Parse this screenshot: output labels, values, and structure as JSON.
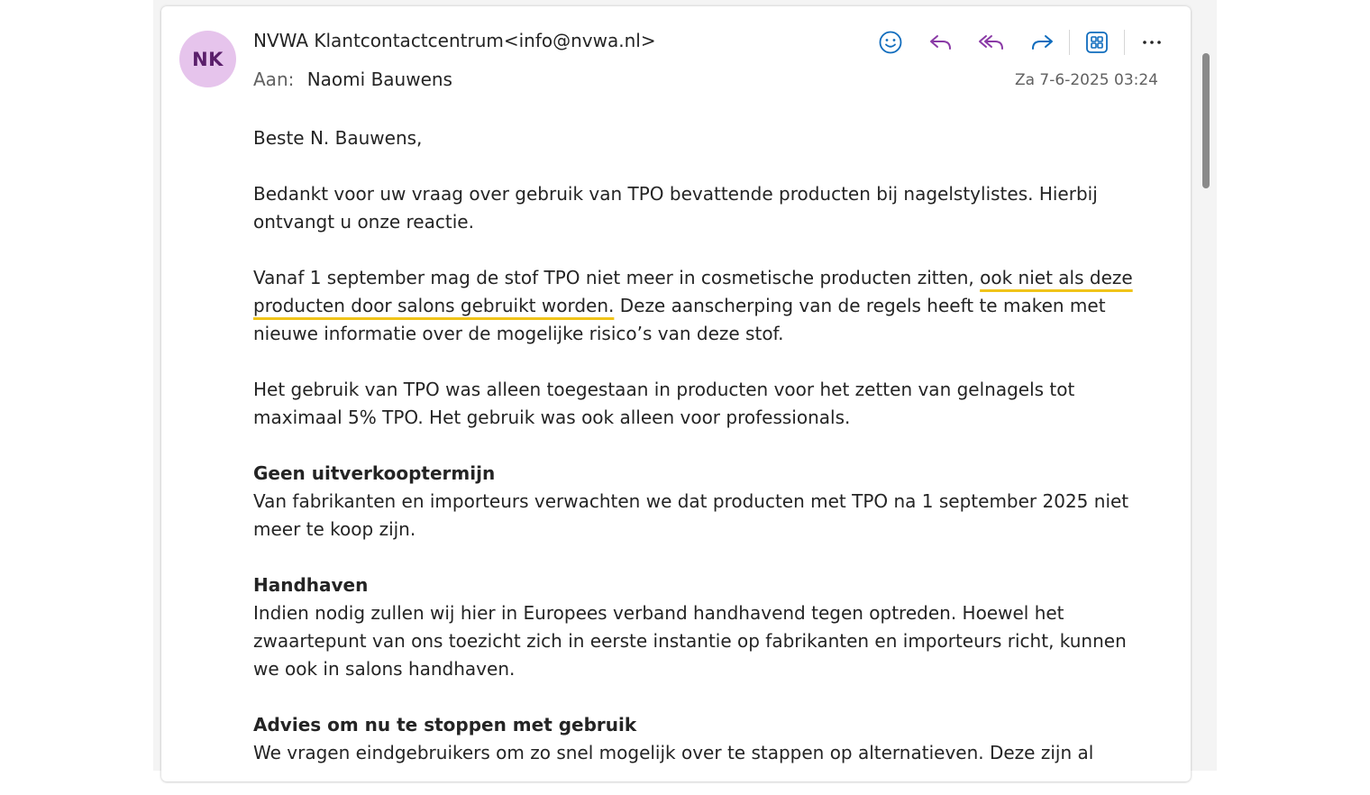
{
  "header": {
    "avatar_initials": "NK",
    "sender": "NVWA Klantcontactcentrum<info@nvwa.nl>",
    "to_label": "Aan:",
    "to_name": "Naomi Bauwens",
    "date": "Za 7-6-2025 03:24"
  },
  "toolbar": {
    "icons": [
      "emoji-icon",
      "reply-icon",
      "reply-all-icon",
      "forward-icon",
      "apps-icon",
      "more-icon"
    ]
  },
  "body": {
    "greeting": "Beste N. Bauwens,",
    "p1": "Bedankt voor uw vraag over gebruik van TPO bevattende producten bij nagelstylistes. Hierbij ontvangt u onze reactie.",
    "p2_before": "Vanaf 1 september mag de stof TPO niet meer in cosmetische producten zitten, ",
    "p2_highlight": "ook niet als deze producten door salons gebruikt worden.",
    "p2_after": " Deze aanscherping van de regels heeft te maken met nieuwe informatie over de mogelijke risico’s van deze stof.",
    "p3": "Het gebruik van TPO was alleen toegestaan in producten voor het zetten van gelnagels tot maximaal 5% TPO. Het gebruik was ook alleen voor professionals.",
    "h1": "Geen uitverkooptermijn",
    "p4": "Van fabrikanten en importeurs verwachten we dat producten met TPO na 1 september 2025 niet meer te koop zijn.",
    "h2": "Handhaven",
    "p5": "Indien nodig zullen wij hier in Europees verband handhavend tegen optreden. Hoewel het zwaartepunt van ons toezicht zich in eerste instantie op fabrikanten en importeurs richt, kunnen we ook in salons handhaven.",
    "h3": "Advies om nu te stoppen met gebruik",
    "p6": "We vragen eindgebruikers om zo snel mogelijk over te stappen op alternatieven. Deze zijn al"
  },
  "colors": {
    "avatar_bg": "#e6c4ec",
    "avatar_text": "#5b1f6b",
    "accent_blue": "#0f6cbd",
    "accent_purple": "#8a3aa6",
    "highlight_underline": "#f0c419"
  }
}
